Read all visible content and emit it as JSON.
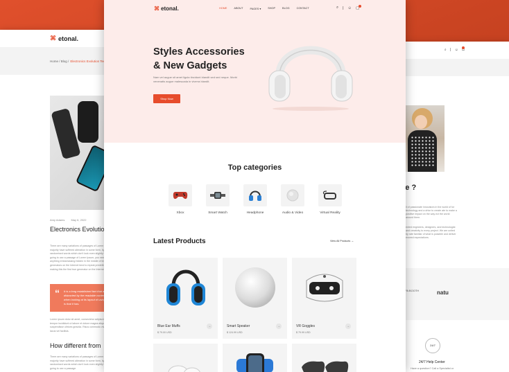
{
  "brand": {
    "mark": "⌘",
    "name": "etonal."
  },
  "left_page": {
    "breadcrumb": [
      "Home",
      "Blog"
    ],
    "breadcrumb_active": "Electronics Evolution Tec",
    "meta_author": "Amy Adams",
    "meta_date": "May 6, 2022",
    "title": "Electronics Evolution Techy",
    "para1": "There are many variations of passages of Lorem Ipsum available, but the majority have suffered alteration in some form, by injected humour, or randomised words which don't look even slightly believable. If you are going to use a passage of Lorem Ipsum, you need to be sure there isn't anything embarrassing hidden in the middle of text.",
    "para2": "generators on the Internet tend to repeat predefined chunks as necessary, making this the first true generator on the Internet. It uses a dictionary.",
    "quote": "It is a long established fact that a reader will be distracted by the readable content of a page when looking at its layout of using Lorem Ipsum is that it has.",
    "para3": "Lorem ipsum dolor sit amet, consectetur adipiscing elit, sed do eiusmod tempor incididunt ut labore et dolore magna aliqua. Quis ipsum suspendisse ultrices gravida. Risus commodo viverra maecenas accumsan lacus vel facilisis.",
    "h2": "How different from",
    "para4": "There are many variations of passages of Lorem Ipsum available, but the majority have suffered alteration in some form, by injected humour, or randomised words which don't look even slightly believable. If you are going to use a passage."
  },
  "right_page": {
    "header_icons": "⌕ | ☺ ▢",
    "heading": "re ?",
    "para1": "ll of passionate innovators in the world of for technology and a drive to create ate to make a positive impact on the way ect the world around them.",
    "para2": "ented engineers, designers, and technologist and creativity to every project. We are united by rate familiar of what is possible and deliver exceed expectations.",
    "brand1": "PA BOOTH",
    "brand2": "natu",
    "help_icon": "24/7",
    "help_title": "24/7 Help Center",
    "help_sub": "Have a question? Call a Specialist or"
  },
  "main_page": {
    "nav": [
      {
        "label": "HOME",
        "active": true
      },
      {
        "label": "ABOUT",
        "active": false
      },
      {
        "label": "PAGES ▾",
        "active": false
      },
      {
        "label": "SHOP",
        "active": false
      },
      {
        "label": "BLOG",
        "active": false
      },
      {
        "label": "CONTACT",
        "active": false
      }
    ],
    "nav_icons": {
      "search": "⌕",
      "divider": "|",
      "user": "☺",
      "cart": "▢"
    },
    "hero": {
      "title": "Styles Accessories & New Gadgets",
      "subtitle": "Nam vel augue sit amet ligula tincidunt blandit sed sed neque. Morbi venenatis augue malesuada in viverra blandit.",
      "button": "Shop Now"
    },
    "categories_title": "Top categories",
    "categories": [
      {
        "label": "Xbox",
        "icon": "gamepad-icon"
      },
      {
        "label": "Smart Watch",
        "icon": "smartwatch-icon"
      },
      {
        "label": "Headphone",
        "icon": "headphone-icon"
      },
      {
        "label": "Audio & Video",
        "icon": "speaker-icon"
      },
      {
        "label": "Virtual Reality",
        "icon": "vr-icon"
      }
    ],
    "latest_title": "Latest Products",
    "view_all": "View All Products →",
    "products": [
      {
        "name": "Blue Ear Muffs",
        "price": "$ 79.00 USD",
        "icon": "ear-muffs-icon"
      },
      {
        "name": "Smart Speaker",
        "price": "$ 124.99 USD",
        "icon": "smart-speaker-icon"
      },
      {
        "name": "VR Goggles",
        "price": "$ 79.99 USD",
        "icon": "vr-goggles-icon"
      }
    ],
    "product_arrow": "→",
    "colors": {
      "accent": "#e74c2c",
      "hero_bg": "#fdecea",
      "card_bg": "#f4f4f4"
    }
  }
}
